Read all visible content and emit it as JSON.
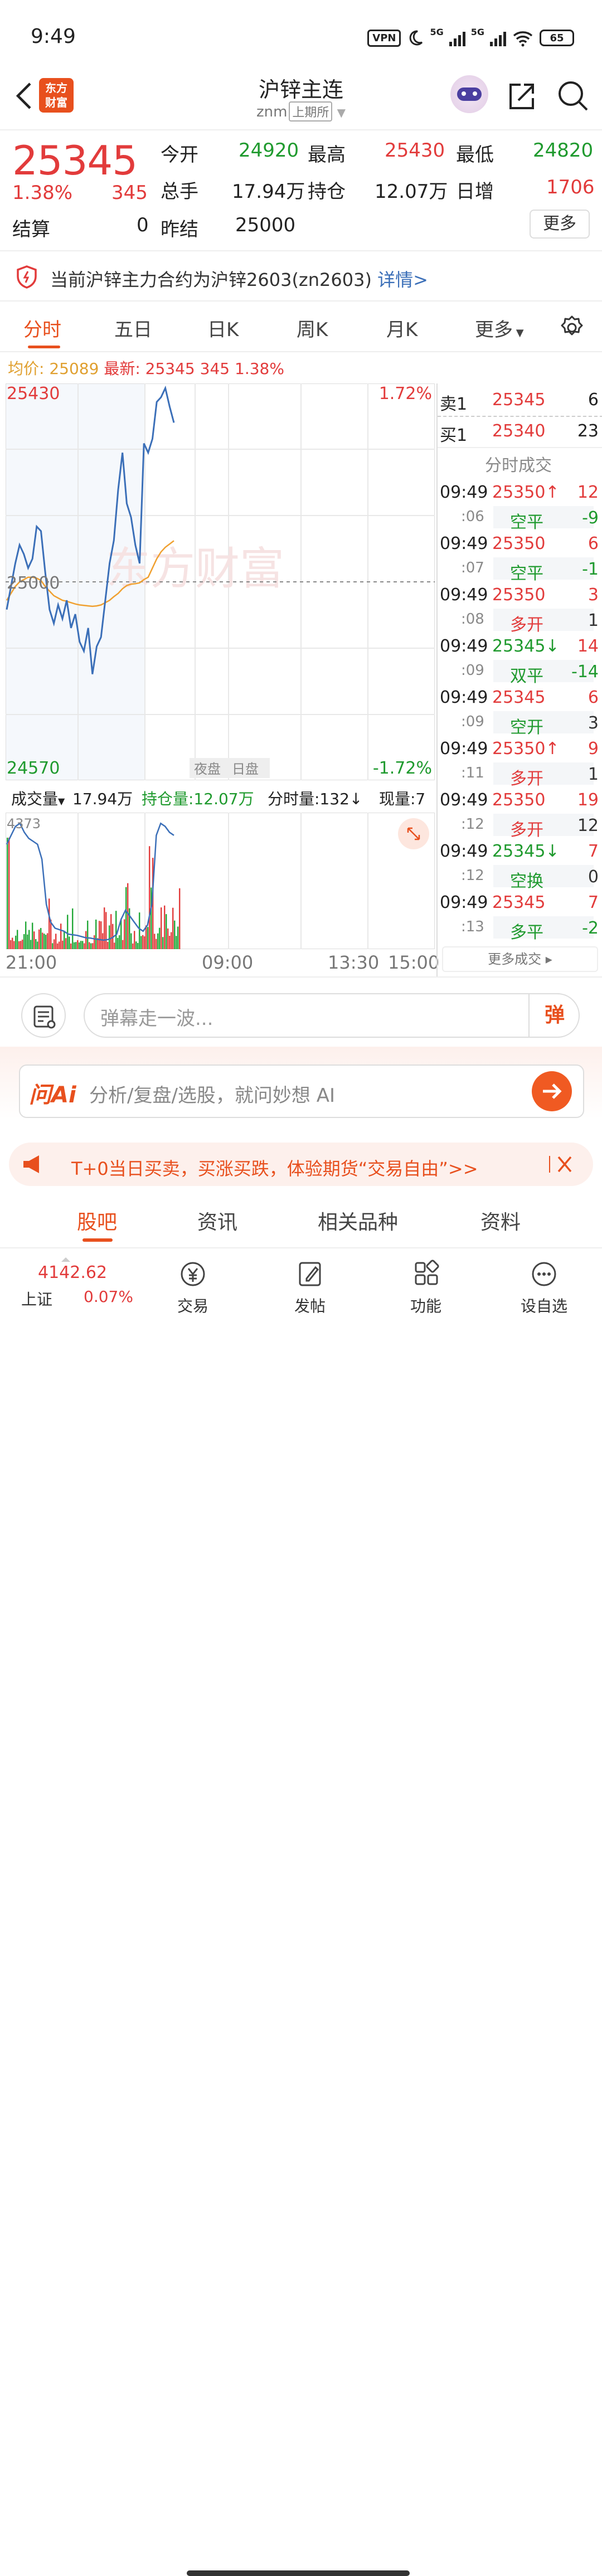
{
  "status": {
    "time": "9:49",
    "vpn": "VPN",
    "net1": "5G",
    "net2": "5G",
    "battery": "65"
  },
  "header": {
    "logo_line1": "东方",
    "logo_line2": "财富",
    "title": "沪锌主连",
    "code": "znm",
    "exchange": "上期所"
  },
  "quote": {
    "price": "25345",
    "change_pct": "1.38%",
    "change": "345",
    "open_label": "今开",
    "open": "24920",
    "high_label": "最高",
    "high": "25430",
    "low_label": "最低",
    "low": "24820",
    "volume_label": "总手",
    "volume": "17.94万",
    "oi_label": "持仓",
    "oi": "12.07万",
    "daily_inc_label": "日增",
    "daily_inc": "1706",
    "settle_label": "结算",
    "settle": "0",
    "prev_settle_label": "昨结",
    "prev_settle": "25000",
    "more": "更多"
  },
  "notice": {
    "text": "当前沪锌主力合约为沪锌2603(zn2603)",
    "link": "详情>"
  },
  "chart_tabs": [
    "分时",
    "五日",
    "日K",
    "周K",
    "月K",
    "更多"
  ],
  "info": {
    "avg_label": "均价:",
    "avg": "25089",
    "last_label": "最新:",
    "last": "25345",
    "chg": "345",
    "pct": "1.38%"
  },
  "chart_labels": {
    "top_price": "25430",
    "mid_price": "25000",
    "bottom_price": "24570",
    "top_pct": "1.72%",
    "bottom_pct": "-1.72%",
    "night": "夜盘",
    "day": "日盘",
    "watermark": "东方财富"
  },
  "volume_bar": {
    "vol_label": "成交量",
    "vol": "17.94万",
    "oi": "持仓量:12.07万",
    "tick": "分时量:132↓",
    "now": "现量:7",
    "max": "4373"
  },
  "xaxis": [
    "21:00",
    "09:00",
    "13:30",
    "15:00"
  ],
  "orderbook": {
    "ask_label": "卖1",
    "ask": "25345",
    "ask_vol": "6",
    "bid_label": "买1",
    "bid": "25340",
    "bid_vol": "23",
    "trades_title": "分时成交",
    "trades": [
      {
        "t": "09:49",
        "p": "25350↑",
        "v": "12",
        "s": ":06",
        "type": "空平",
        "d": "-9"
      },
      {
        "t": "09:49",
        "p": "25350",
        "v": "6",
        "s": ":07",
        "type": "空平",
        "d": "-1"
      },
      {
        "t": "09:49",
        "p": "25350",
        "v": "3",
        "s": ":08",
        "type": "多开",
        "d": "1"
      },
      {
        "t": "09:49",
        "p": "25345↓",
        "v": "14",
        "s": ":09",
        "type": "双平",
        "d": "-14"
      },
      {
        "t": "09:49",
        "p": "25345",
        "v": "6",
        "s": ":09",
        "type": "空开",
        "d": "3"
      },
      {
        "t": "09:49",
        "p": "25350↑",
        "v": "9",
        "s": ":11",
        "type": "多开",
        "d": "1"
      },
      {
        "t": "09:49",
        "p": "25350",
        "v": "19",
        "s": ":12",
        "type": "多开",
        "d": "12"
      },
      {
        "t": "09:49",
        "p": "25345↓",
        "v": "7",
        "s": ":12",
        "type": "空换",
        "d": "0"
      },
      {
        "t": "09:49",
        "p": "25345",
        "v": "7",
        "s": ":13",
        "type": "多平",
        "d": "-2"
      }
    ],
    "more": "更多成交 ▸"
  },
  "danmu": {
    "placeholder": "弹幕走一波...",
    "btn": "弹"
  },
  "ai": {
    "logo": "问Ai",
    "placeholder": "分析/复盘/选股，就问妙想 AI"
  },
  "promo": {
    "text": "T+0当日买卖，买涨买跌，体验期货“交易自由”>>"
  },
  "bottom_tabs": [
    "股吧",
    "资讯",
    "相关品种",
    "资料"
  ],
  "nav": {
    "index_value": "4142.62",
    "index_name": "上证",
    "index_pct": "0.07%",
    "items": [
      "交易",
      "发帖",
      "功能",
      "设自选"
    ]
  },
  "colors": {
    "accent": "#e8501e",
    "up": "#e23b3b",
    "down": "#1f9a2e",
    "price_line": "#3b6fb8",
    "avg_line": "#f0a030"
  },
  "chart_data": {
    "type": "line",
    "title": "",
    "ylim": [
      24570,
      25430
    ],
    "x_ticks": [
      "21:00",
      "09:00",
      "13:30",
      "15:00"
    ],
    "series": [
      {
        "name": "最新",
        "values": [
          24940,
          24990,
          25040,
          25080,
          25060,
          25030,
          25050,
          25120,
          25110,
          25020,
          24940,
          24910,
          24950,
          24920,
          24960,
          24900,
          24930,
          24870,
          24850,
          24900,
          24800,
          24860,
          24880,
          24960,
          25040,
          25090,
          25200,
          25280,
          25170,
          25140,
          25080,
          25040,
          25300,
          25280,
          25310,
          25390,
          25400,
          25420,
          25380,
          25345
        ]
      },
      {
        "name": "均价",
        "values": [
          24960,
          24975,
          24990,
          25000,
          25005,
          25010,
          25010,
          25008,
          25003,
          24990,
          24980,
          24970,
          24965,
          24960,
          24958,
          24955,
          24952,
          24950,
          24949,
          24948,
          24947,
          24948,
          24950,
          24955,
          24960,
          24968,
          24975,
          24985,
          24992,
          24995,
          24996,
          24998,
          25005,
          25010,
          25030,
          25050,
          25065,
          25075,
          25082,
          25089
        ]
      }
    ],
    "volume": {
      "max": 4373,
      "oi_series": [
        3500,
        3800,
        4100,
        4200,
        3900,
        3700,
        3600,
        3500,
        3000,
        1500,
        900,
        700,
        650,
        600,
        500,
        480,
        460,
        420,
        380,
        370,
        340,
        320,
        300,
        320,
        380,
        500,
        1000,
        1300,
        1100,
        900,
        700,
        600,
        800,
        1500,
        3800,
        4200,
        4100,
        3900,
        3800
      ]
    }
  }
}
